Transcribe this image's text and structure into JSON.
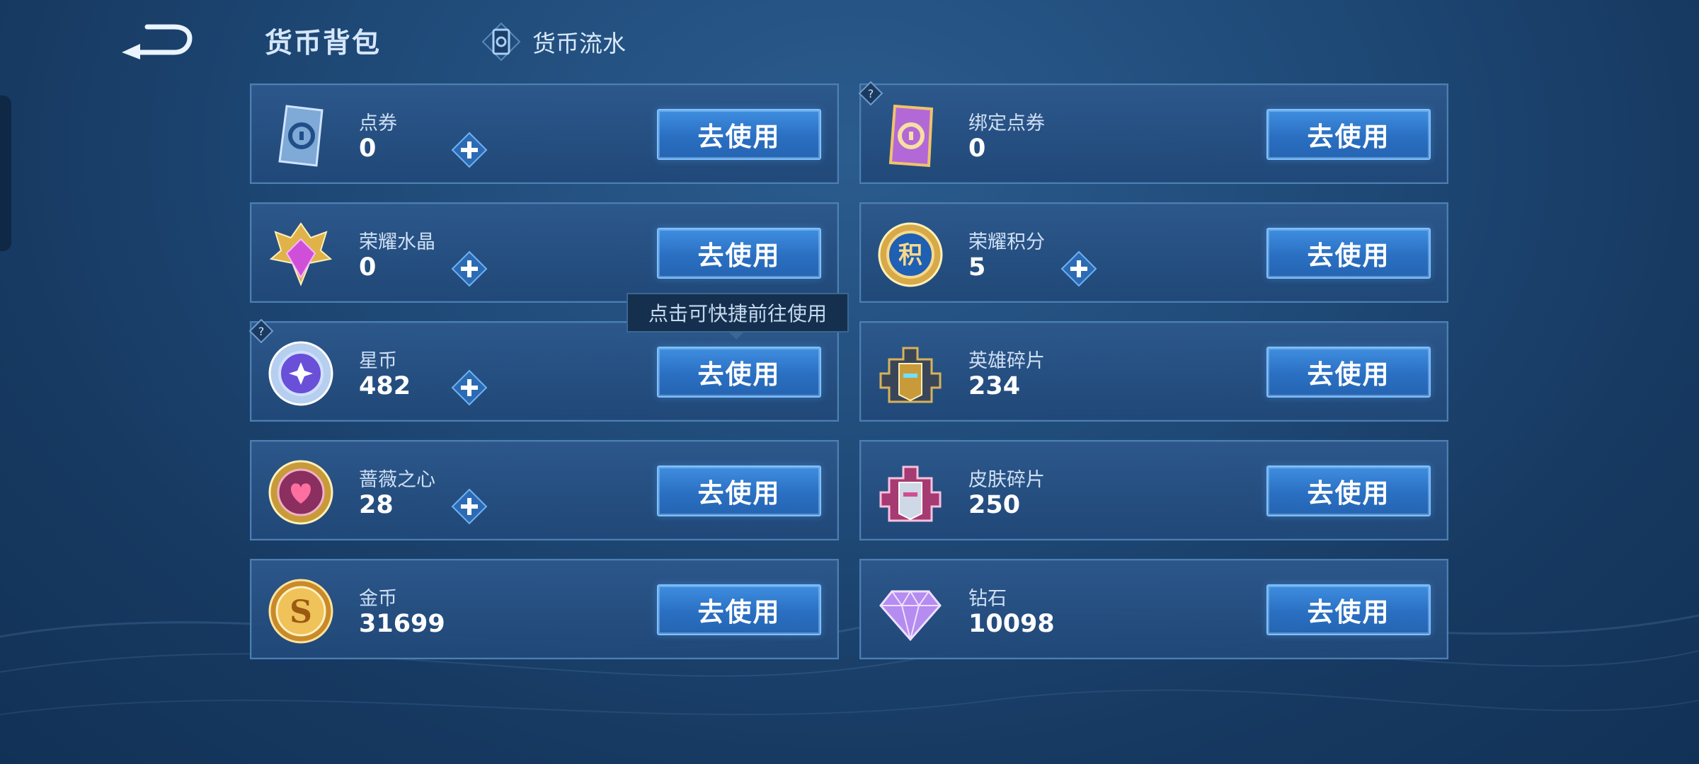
{
  "header": {
    "title": "货币背包",
    "flow_link_label": "货币流水",
    "back_icon": "back-arrow-icon"
  },
  "tooltip": {
    "text": "点击可快捷前往使用"
  },
  "currencies": [
    {
      "name": "点券",
      "count": "0",
      "button": "去使用",
      "icon": "ticket-icon",
      "has_plus": true,
      "has_help": false
    },
    {
      "name": "绑定点券",
      "count": "0",
      "button": "去使用",
      "icon": "bound-ticket-icon",
      "has_plus": false,
      "has_help": true
    },
    {
      "name": "荣耀水晶",
      "count": "0",
      "button": "去使用",
      "icon": "glory-crystal-icon",
      "has_plus": true,
      "has_help": false
    },
    {
      "name": "荣耀积分",
      "count": "5",
      "button": "去使用",
      "icon": "glory-points-icon",
      "has_plus": true,
      "has_help": false
    },
    {
      "name": "星币",
      "count": "482",
      "button": "去使用",
      "icon": "star-coin-icon",
      "has_plus": true,
      "has_help": true
    },
    {
      "name": "英雄碎片",
      "count": "234",
      "button": "去使用",
      "icon": "hero-fragment-icon",
      "has_plus": false,
      "has_help": false
    },
    {
      "name": "蔷薇之心",
      "count": "28",
      "button": "去使用",
      "icon": "rose-heart-icon",
      "has_plus": true,
      "has_help": false
    },
    {
      "name": "皮肤碎片",
      "count": "250",
      "button": "去使用",
      "icon": "skin-fragment-icon",
      "has_plus": false,
      "has_help": false
    },
    {
      "name": "金币",
      "count": "31699",
      "button": "去使用",
      "icon": "gold-coin-icon",
      "has_plus": false,
      "has_help": false
    },
    {
      "name": "钻石",
      "count": "10098",
      "button": "去使用",
      "icon": "diamond-icon",
      "has_plus": false,
      "has_help": false
    }
  ],
  "colors": {
    "accent_button": "#2a6fc2",
    "card_border": "#4c7fb3",
    "background": "#1f4a78"
  }
}
